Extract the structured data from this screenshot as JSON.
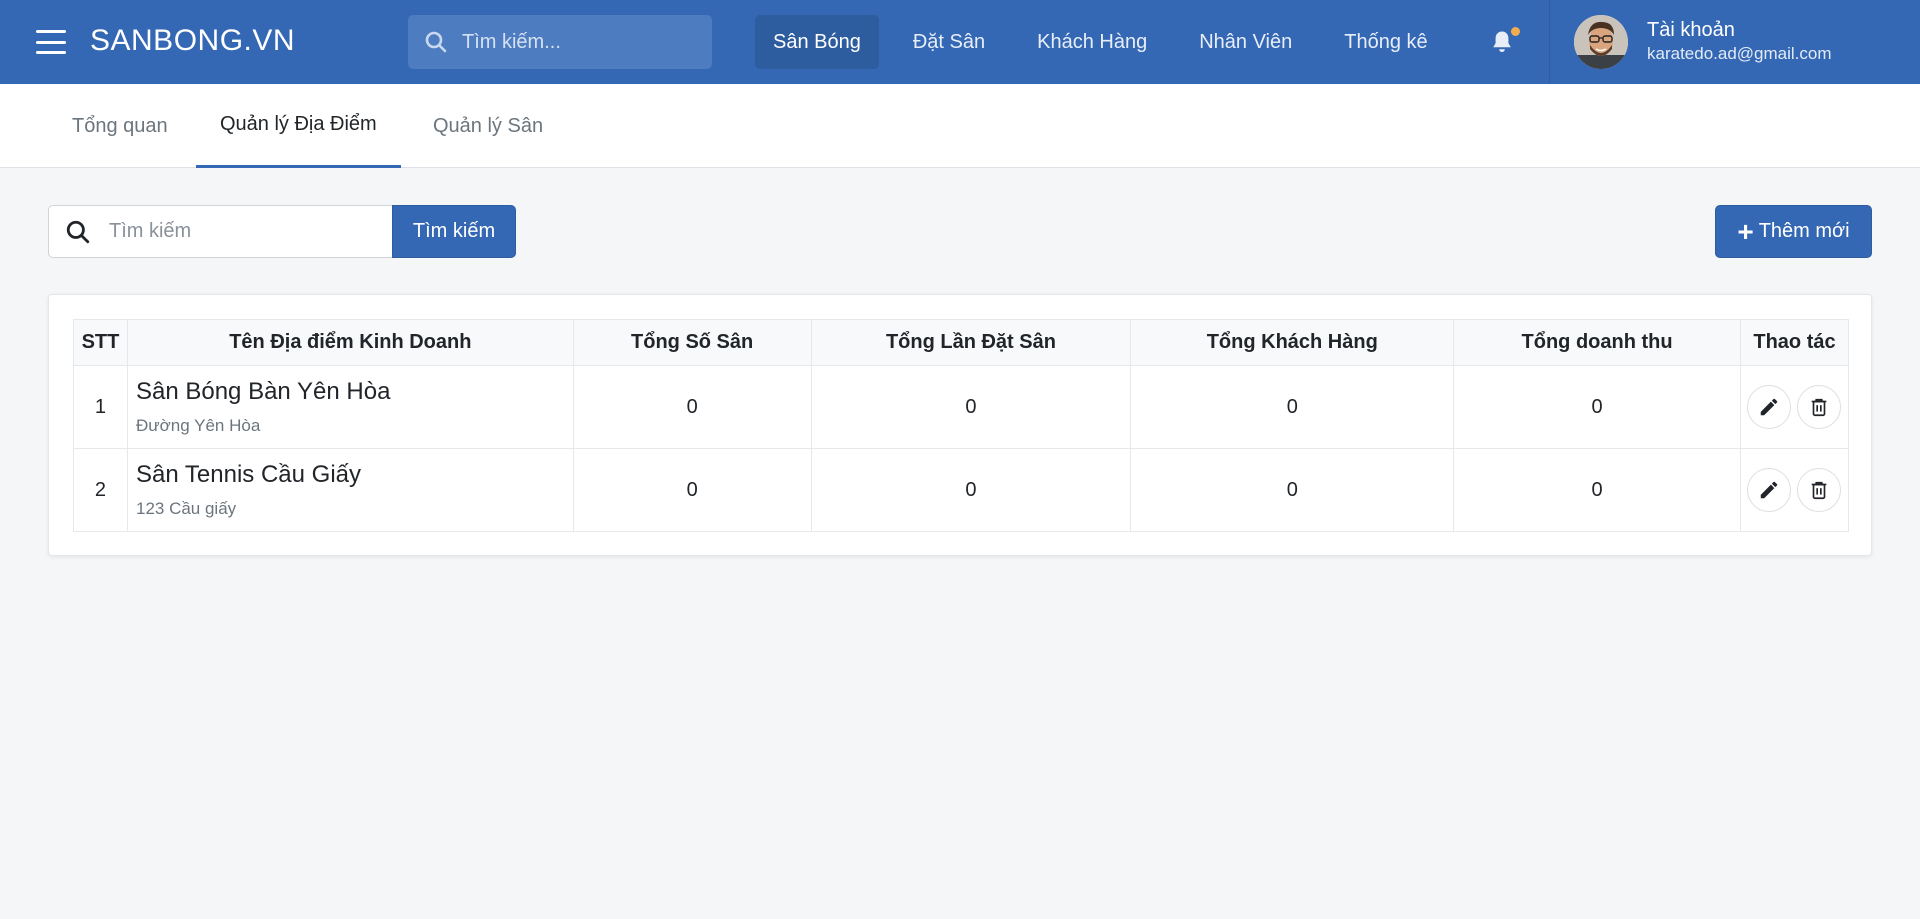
{
  "app": {
    "brand": "SANBONG.VN"
  },
  "nav": {
    "search_placeholder": "Tìm kiếm...",
    "links": [
      {
        "label": "Sân Bóng",
        "active": true
      },
      {
        "label": "Đặt Sân",
        "active": false
      },
      {
        "label": "Khách Hàng",
        "active": false
      },
      {
        "label": "Nhân Viên",
        "active": false
      },
      {
        "label": "Thống kê",
        "active": false
      }
    ],
    "notification_dot_color": "#f0ad4e"
  },
  "account": {
    "name": "Tài khoản",
    "email": "karatedo.ad@gmail.com"
  },
  "tabs": [
    {
      "label": "Tổng quan",
      "active": false
    },
    {
      "label": "Quản lý Địa Điểm",
      "active": true
    },
    {
      "label": "Quản lý Sân",
      "active": false
    }
  ],
  "toolbar": {
    "search_placeholder": "Tìm kiếm",
    "search_button": "Tìm kiếm",
    "add_button": "Thêm mới"
  },
  "table": {
    "headers": [
      "STT",
      "Tên Địa điểm Kinh Doanh",
      "Tổng Số Sân",
      "Tổng Lần Đặt Sân",
      "Tổng Khách Hàng",
      "Tổng doanh thu",
      "Thao tác"
    ],
    "rows": [
      {
        "stt": "1",
        "name": "Sân Bóng Bàn Yên Hòa",
        "address": "Đường Yên Hòa",
        "total_courts": "0",
        "total_bookings": "0",
        "total_customers": "0",
        "total_revenue": "0"
      },
      {
        "stt": "2",
        "name": "Sân Tennis Cầu Giấy",
        "address": "123 Cầu giấy",
        "total_courts": "0",
        "total_bookings": "0",
        "total_customers": "0",
        "total_revenue": "0"
      }
    ]
  },
  "colors": {
    "primary": "#3468b4",
    "primary_dark": "#2d5c9f",
    "background": "#f4f6f8"
  },
  "icons": {
    "menu": "hamburger-icon",
    "search": "search-icon",
    "bell": "bell-icon",
    "add": "plus-icon",
    "edit": "pencil-icon",
    "delete": "trash-icon"
  }
}
